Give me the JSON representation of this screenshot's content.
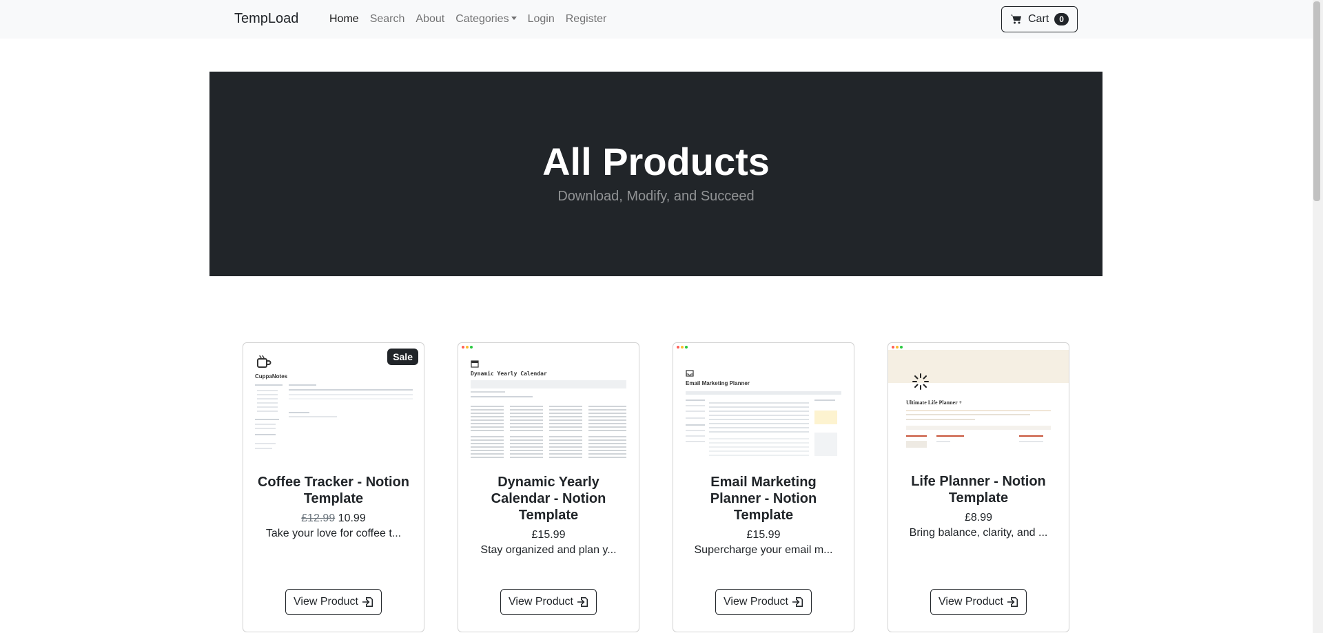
{
  "navbar": {
    "brand": "TempLoad",
    "links": [
      "Home",
      "Search",
      "About",
      "Categories",
      "Login",
      "Register"
    ],
    "cart_label": "Cart",
    "cart_count": "0"
  },
  "hero": {
    "title": "All Products",
    "subtitle": "Download, Modify, and Succeed"
  },
  "products": [
    {
      "title": "Coffee Tracker - Notion Template",
      "old_price": "£12.99",
      "price": "10.99",
      "description": "Take your love for coffee t...",
      "badge": "Sale",
      "button": "View Product",
      "thumb_title": "CuppaNotes"
    },
    {
      "title": "Dynamic Yearly Calendar - Notion Template",
      "price": "£15.99",
      "description": "Stay organized and plan y...",
      "button": "View Product",
      "thumb_title": "Dynamic Yearly Calendar"
    },
    {
      "title": "Email Marketing Planner - Notion Template",
      "price": "£15.99",
      "description": "Supercharge your email m...",
      "button": "View Product",
      "thumb_title": "Email Marketing Planner"
    },
    {
      "title": "Life Planner - Notion Template",
      "price": "£8.99",
      "description": "Bring balance, clarity, and ...",
      "button": "View Product",
      "thumb_title": "Ultimate Life Planner +"
    }
  ],
  "colors": {
    "dark": "#212529",
    "navbar_bg": "#f8f9fa",
    "muted": "#6c757d"
  },
  "icons": {
    "cart": "cart-icon",
    "view": "box-arrow-in-icon",
    "spinner": "spinner-icon"
  }
}
